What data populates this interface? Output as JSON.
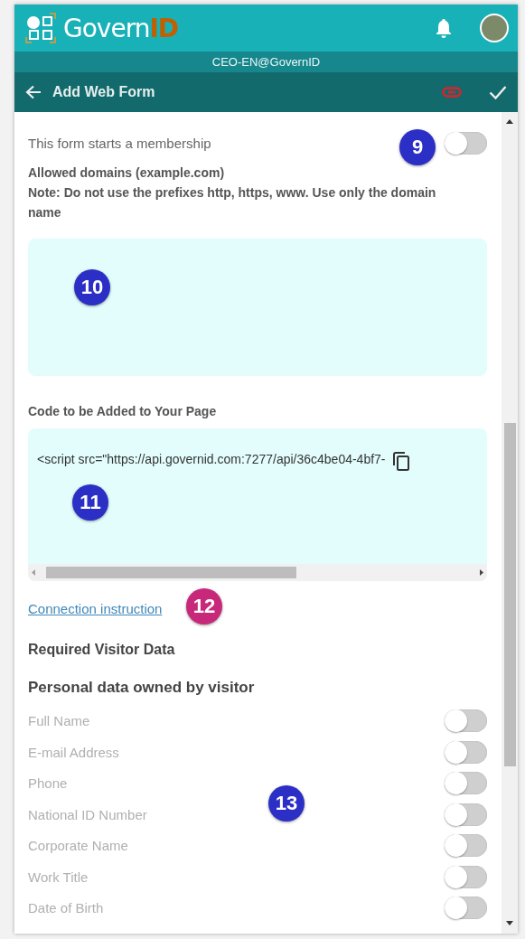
{
  "header": {
    "logo": {
      "name": "Govern",
      "suffix": "ID"
    },
    "account": "CEO-EN@GovernID"
  },
  "toolbar": {
    "title": "Add Web Form"
  },
  "membership": {
    "label": "This form starts a membership",
    "on": false
  },
  "domains": {
    "label": "Allowed domains (example.com)",
    "note": "Note: Do not use the prefixes http, https, www. Use only the domain name"
  },
  "code": {
    "label": "Code to be Added to Your Page",
    "value": "<script src=\"https://api.governid.com:7277/api/36c4be04-4bf7-"
  },
  "link": "Connection instruction",
  "required_heading": "Required Visitor Data",
  "personal_heading": "Personal data owned by visitor",
  "fields": [
    {
      "label": "Full Name",
      "on": false
    },
    {
      "label": "E-mail Address",
      "on": false
    },
    {
      "label": "Phone",
      "on": false
    },
    {
      "label": "National ID Number",
      "on": false
    },
    {
      "label": "Corporate Name",
      "on": false
    },
    {
      "label": "Work Title",
      "on": false
    },
    {
      "label": "Date of Birth",
      "on": false
    }
  ],
  "callouts": [
    {
      "number": "9",
      "color": "#2b2fc6"
    },
    {
      "number": "10",
      "color": "#2b2fc6"
    },
    {
      "number": "11",
      "color": "#2b2fc6"
    },
    {
      "number": "12",
      "color": "#c8287a"
    },
    {
      "number": "13",
      "color": "#2b2fc6"
    }
  ]
}
